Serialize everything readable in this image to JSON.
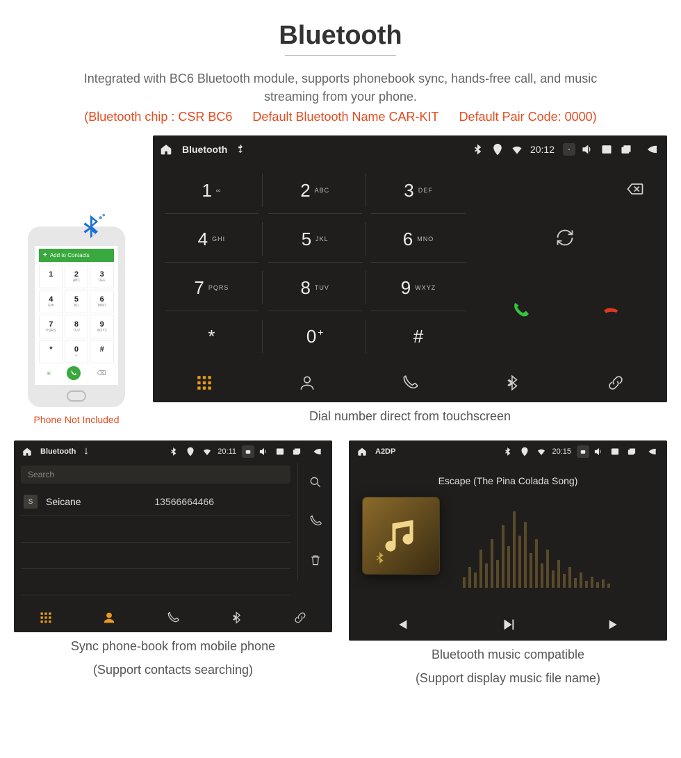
{
  "page": {
    "title": "Bluetooth",
    "description": "Integrated with BC6 Bluetooth module, supports phonebook sync, hands-free call, and music streaming from your phone.",
    "spec1": "(Bluetooth chip : CSR BC6",
    "spec2": "Default Bluetooth Name CAR-KIT",
    "spec3": "Default Pair Code: 0000)",
    "phone_note": "Phone Not Included",
    "phone_bar": "Add to Contacts",
    "caption_main": "Dial number direct from touchscreen",
    "caption_pb1": "Sync phone-book from mobile phone",
    "caption_pb2": "(Support contacts searching)",
    "caption_mu1": "Bluetooth music compatible",
    "caption_mu2": "(Support display music file name)"
  },
  "main_device": {
    "app": "Bluetooth",
    "time": "20:12",
    "keys": [
      {
        "n": "1",
        "l": "∞"
      },
      {
        "n": "2",
        "l": "ABC"
      },
      {
        "n": "3",
        "l": "DEF"
      },
      {
        "n": "4",
        "l": "GHI"
      },
      {
        "n": "5",
        "l": "JKL"
      },
      {
        "n": "6",
        "l": "MNO"
      },
      {
        "n": "7",
        "l": "PQRS"
      },
      {
        "n": "8",
        "l": "TUV"
      },
      {
        "n": "9",
        "l": "WXYZ"
      },
      {
        "n": "*",
        "l": ""
      },
      {
        "n": "0",
        "l": "+",
        "up": true
      },
      {
        "n": "#",
        "l": ""
      }
    ]
  },
  "pb": {
    "app": "Bluetooth",
    "time": "20:11",
    "search": "Search",
    "contacts": [
      {
        "initial": "S",
        "name": "Seicane",
        "number": "13566664466"
      }
    ]
  },
  "music": {
    "app": "A2DP",
    "time": "20:15",
    "track": "Escape (The Pina Colada Song)"
  },
  "phone_keys": [
    {
      "n": "1",
      "l": ""
    },
    {
      "n": "2",
      "l": "ABC"
    },
    {
      "n": "3",
      "l": "DEF"
    },
    {
      "n": "4",
      "l": "GHI"
    },
    {
      "n": "5",
      "l": "JKL"
    },
    {
      "n": "6",
      "l": "MNO"
    },
    {
      "n": "7",
      "l": "PQRS"
    },
    {
      "n": "8",
      "l": "TUV"
    },
    {
      "n": "9",
      "l": "WXYZ"
    },
    {
      "n": "*",
      "l": ""
    },
    {
      "n": "0",
      "l": "+"
    },
    {
      "n": "#",
      "l": ""
    }
  ]
}
